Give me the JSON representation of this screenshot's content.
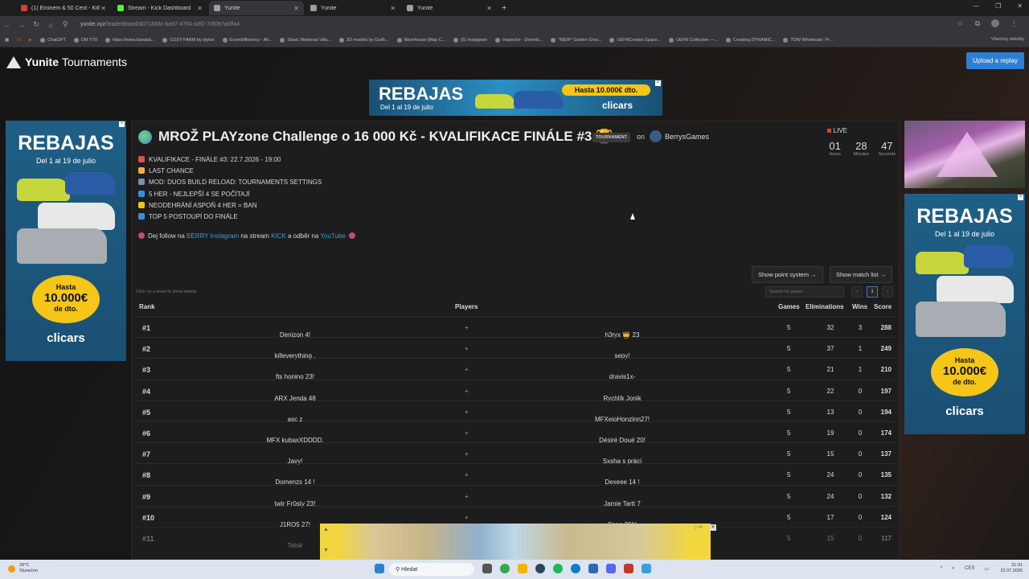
{
  "browser": {
    "tabs": [
      {
        "title": "(1) Eminem & 50 Cent - Kill or Be",
        "color": "#e53935",
        "active": false
      },
      {
        "title": "Stream - Kick Dashboard",
        "color": "#53fc18",
        "active": false
      },
      {
        "title": "Yunite",
        "color": "#9e9e9e",
        "active": true
      },
      {
        "title": "Yunite",
        "color": "#9e9e9e",
        "active": false
      },
      {
        "title": "Yunite",
        "color": "#9e9e9e",
        "active": false
      }
    ],
    "url_host": "yunite.xyz",
    "url_path": "/leaderboard/d071493c-ba97-4764-a3f2-70f097a0ffa4",
    "bookmarks": [
      "ChatGPT",
      "DM YT8",
      "https://www.barakal...",
      "COZY FARM by styloo",
      "EcomEfficiency - All...",
      "Slavic Medieval Villa...",
      "3D models by Guilh...",
      "Warehouse [Map C...",
      "(5) Instagram",
      "Inspector - Downlo...",
      "*NEW* Golden Grov...",
      "UEFNCreator.Space...",
      "UEFN Collective —...",
      "Creating DYNAMIC...",
      "TDW Wholesale: Pr..."
    ],
    "bookmarks_all": "Všechny záložky"
  },
  "header": {
    "brand": "Yunite",
    "brand_suffix": "Tournaments",
    "upload_label": "Upload a replay"
  },
  "ads": {
    "title": "REBAJAS",
    "subtitle": "Del 1 al 19 de julio",
    "promo_top": "Hasta",
    "promo_amount": "10.000€",
    "promo_bottom": "de dto.",
    "promo_inline": "Hasta 10.000€ dto.",
    "brand": "clicars",
    "close": "×"
  },
  "tournament": {
    "title": "MROŽ PLAYzone Challenge o 16 000 Kč - KVALIFIKACE FINÁLE #3 🏆",
    "badge": "TOURNAMENT",
    "on": "on",
    "organizer": "BerrysGames",
    "live": "LIVE",
    "countdown": {
      "hours": "01",
      "hours_label": "Hours",
      "minutes": "28",
      "minutes_label": "Minutes",
      "seconds": "47",
      "seconds_label": "Seconds"
    },
    "info": [
      {
        "text": "KVALIFIKACE - FINÁLE #3: 22.7.2026 - 19:00",
        "color": "#d9534f"
      },
      {
        "text": "LAST CHANCE",
        "color": "#f0ad4e"
      },
      {
        "text": "MOD: DUOS BUILD RELOAD: TOURNAMENTS SETTINGS",
        "color": "#7b8fa6"
      },
      {
        "text": "5 HER - NEJLEPŠÍ 4 SE POČÍTAJÍ",
        "color": "#3a8fd9"
      },
      {
        "text": "NEODEHRÁNÍ ASPOŇ 4 HER = BAN",
        "color": "#f0c419"
      },
      {
        "text": "TOP 5 POSTOUPÍ DO FINÁLE",
        "color": "#3a8fd9"
      }
    ],
    "follow": {
      "pre": "Dej follow na",
      "link1": "BERRY Instagram",
      "mid1": "na stream",
      "link2": "KICK",
      "mid2": "a odběr na",
      "link3": "YouTube"
    }
  },
  "controls": {
    "point_system": "Show point system →",
    "match_list": "Show match list →",
    "hint": "Click on a team to show details",
    "search_placeholder": "Search for player ...",
    "page_prev": "‹",
    "page_current": "1",
    "page_next": "›"
  },
  "table": {
    "headers": {
      "rank": "Rank",
      "players": "Players",
      "games": "Games",
      "elims": "Eliminations",
      "wins": "Wins",
      "score": "Score"
    },
    "rows": [
      {
        "rank": "#1",
        "p1": "Denizon 4!",
        "p2": "h3ryx 👑 23",
        "games": "5",
        "elims": "32",
        "wins": "3",
        "score": "288"
      },
      {
        "rank": "#2",
        "p1": "killeverything .",
        "p2": "sepy!",
        "games": "5",
        "elims": "37",
        "wins": "1",
        "score": "249"
      },
      {
        "rank": "#3",
        "p1": "fts honino 23!",
        "p2": "dravis1x-",
        "games": "5",
        "elims": "21",
        "wins": "1",
        "score": "210"
      },
      {
        "rank": "#4",
        "p1": "ARX Jenda 48",
        "p2": "Rychlík Jonik",
        "games": "5",
        "elims": "22",
        "wins": "0",
        "score": "197"
      },
      {
        "rank": "#5",
        "p1": "asc z",
        "p2": "MFXeioHonzinn27!",
        "games": "5",
        "elims": "13",
        "wins": "0",
        "score": "194"
      },
      {
        "rank": "#6",
        "p1": "MFX kubaxXDDDD.",
        "p2": "Désiré Doué 20!",
        "games": "5",
        "elims": "19",
        "wins": "0",
        "score": "174"
      },
      {
        "rank": "#7",
        "p1": "Javy!",
        "p2": "Sxsha s prácí",
        "games": "5",
        "elims": "15",
        "wins": "0",
        "score": "137"
      },
      {
        "rank": "#8",
        "p1": "Domenzs 14 !",
        "p2": "Dexeee 14 !",
        "games": "5",
        "elims": "24",
        "wins": "0",
        "score": "135"
      },
      {
        "rank": "#9",
        "p1": "twtr Fr0sty 23!",
        "p2": "Jamie Tartt 7",
        "games": "5",
        "elims": "24",
        "wins": "0",
        "score": "132"
      },
      {
        "rank": "#10",
        "p1": "J1RO5 27!",
        "p2": "Spas 281!",
        "games": "5",
        "elims": "17",
        "wins": "0",
        "score": "124"
      },
      {
        "rank": "#11",
        "p1": "Tebik",
        "p2": "",
        "games": "5",
        "elims": "15",
        "wins": "0",
        "score": "117"
      }
    ]
  },
  "taskbar": {
    "temp": "28°C",
    "weather": "Slunečno",
    "search": "Hledat",
    "lang": "CES",
    "time": "21:31",
    "date": "22.07.2026"
  }
}
